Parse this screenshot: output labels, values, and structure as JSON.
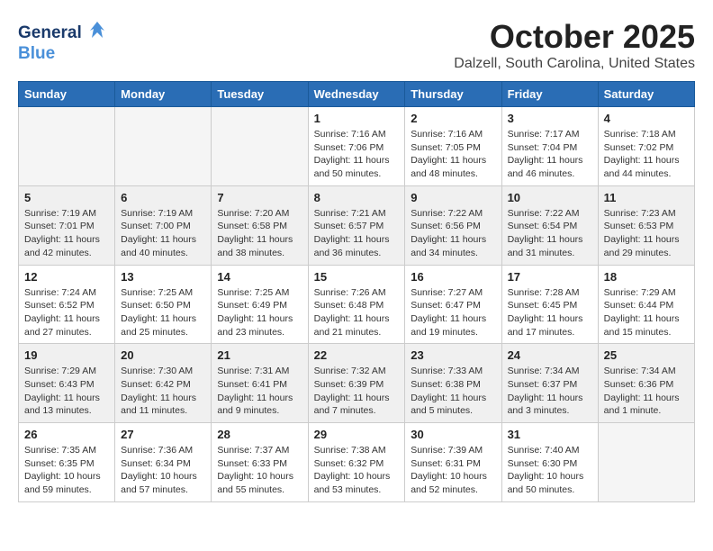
{
  "header": {
    "logo_line1": "General",
    "logo_line2": "Blue",
    "month_title": "October 2025",
    "location": "Dalzell, South Carolina, United States"
  },
  "weekdays": [
    "Sunday",
    "Monday",
    "Tuesday",
    "Wednesday",
    "Thursday",
    "Friday",
    "Saturday"
  ],
  "weeks": [
    [
      {
        "day": "",
        "info": ""
      },
      {
        "day": "",
        "info": ""
      },
      {
        "day": "",
        "info": ""
      },
      {
        "day": "1",
        "info": "Sunrise: 7:16 AM\nSunset: 7:06 PM\nDaylight: 11 hours\nand 50 minutes."
      },
      {
        "day": "2",
        "info": "Sunrise: 7:16 AM\nSunset: 7:05 PM\nDaylight: 11 hours\nand 48 minutes."
      },
      {
        "day": "3",
        "info": "Sunrise: 7:17 AM\nSunset: 7:04 PM\nDaylight: 11 hours\nand 46 minutes."
      },
      {
        "day": "4",
        "info": "Sunrise: 7:18 AM\nSunset: 7:02 PM\nDaylight: 11 hours\nand 44 minutes."
      }
    ],
    [
      {
        "day": "5",
        "info": "Sunrise: 7:19 AM\nSunset: 7:01 PM\nDaylight: 11 hours\nand 42 minutes."
      },
      {
        "day": "6",
        "info": "Sunrise: 7:19 AM\nSunset: 7:00 PM\nDaylight: 11 hours\nand 40 minutes."
      },
      {
        "day": "7",
        "info": "Sunrise: 7:20 AM\nSunset: 6:58 PM\nDaylight: 11 hours\nand 38 minutes."
      },
      {
        "day": "8",
        "info": "Sunrise: 7:21 AM\nSunset: 6:57 PM\nDaylight: 11 hours\nand 36 minutes."
      },
      {
        "day": "9",
        "info": "Sunrise: 7:22 AM\nSunset: 6:56 PM\nDaylight: 11 hours\nand 34 minutes."
      },
      {
        "day": "10",
        "info": "Sunrise: 7:22 AM\nSunset: 6:54 PM\nDaylight: 11 hours\nand 31 minutes."
      },
      {
        "day": "11",
        "info": "Sunrise: 7:23 AM\nSunset: 6:53 PM\nDaylight: 11 hours\nand 29 minutes."
      }
    ],
    [
      {
        "day": "12",
        "info": "Sunrise: 7:24 AM\nSunset: 6:52 PM\nDaylight: 11 hours\nand 27 minutes."
      },
      {
        "day": "13",
        "info": "Sunrise: 7:25 AM\nSunset: 6:50 PM\nDaylight: 11 hours\nand 25 minutes."
      },
      {
        "day": "14",
        "info": "Sunrise: 7:25 AM\nSunset: 6:49 PM\nDaylight: 11 hours\nand 23 minutes."
      },
      {
        "day": "15",
        "info": "Sunrise: 7:26 AM\nSunset: 6:48 PM\nDaylight: 11 hours\nand 21 minutes."
      },
      {
        "day": "16",
        "info": "Sunrise: 7:27 AM\nSunset: 6:47 PM\nDaylight: 11 hours\nand 19 minutes."
      },
      {
        "day": "17",
        "info": "Sunrise: 7:28 AM\nSunset: 6:45 PM\nDaylight: 11 hours\nand 17 minutes."
      },
      {
        "day": "18",
        "info": "Sunrise: 7:29 AM\nSunset: 6:44 PM\nDaylight: 11 hours\nand 15 minutes."
      }
    ],
    [
      {
        "day": "19",
        "info": "Sunrise: 7:29 AM\nSunset: 6:43 PM\nDaylight: 11 hours\nand 13 minutes."
      },
      {
        "day": "20",
        "info": "Sunrise: 7:30 AM\nSunset: 6:42 PM\nDaylight: 11 hours\nand 11 minutes."
      },
      {
        "day": "21",
        "info": "Sunrise: 7:31 AM\nSunset: 6:41 PM\nDaylight: 11 hours\nand 9 minutes."
      },
      {
        "day": "22",
        "info": "Sunrise: 7:32 AM\nSunset: 6:39 PM\nDaylight: 11 hours\nand 7 minutes."
      },
      {
        "day": "23",
        "info": "Sunrise: 7:33 AM\nSunset: 6:38 PM\nDaylight: 11 hours\nand 5 minutes."
      },
      {
        "day": "24",
        "info": "Sunrise: 7:34 AM\nSunset: 6:37 PM\nDaylight: 11 hours\nand 3 minutes."
      },
      {
        "day": "25",
        "info": "Sunrise: 7:34 AM\nSunset: 6:36 PM\nDaylight: 11 hours\nand 1 minute."
      }
    ],
    [
      {
        "day": "26",
        "info": "Sunrise: 7:35 AM\nSunset: 6:35 PM\nDaylight: 10 hours\nand 59 minutes."
      },
      {
        "day": "27",
        "info": "Sunrise: 7:36 AM\nSunset: 6:34 PM\nDaylight: 10 hours\nand 57 minutes."
      },
      {
        "day": "28",
        "info": "Sunrise: 7:37 AM\nSunset: 6:33 PM\nDaylight: 10 hours\nand 55 minutes."
      },
      {
        "day": "29",
        "info": "Sunrise: 7:38 AM\nSunset: 6:32 PM\nDaylight: 10 hours\nand 53 minutes."
      },
      {
        "day": "30",
        "info": "Sunrise: 7:39 AM\nSunset: 6:31 PM\nDaylight: 10 hours\nand 52 minutes."
      },
      {
        "day": "31",
        "info": "Sunrise: 7:40 AM\nSunset: 6:30 PM\nDaylight: 10 hours\nand 50 minutes."
      },
      {
        "day": "",
        "info": ""
      }
    ]
  ]
}
